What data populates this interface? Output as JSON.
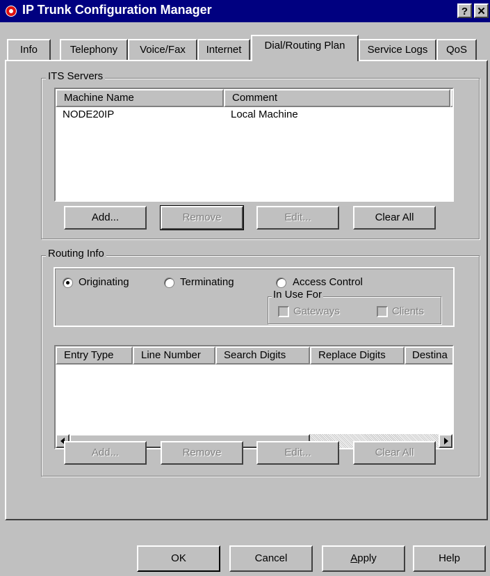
{
  "window": {
    "title": "IP Trunk Configuration Manager",
    "help_glyph": "?",
    "close_glyph": "✕"
  },
  "tabs": [
    {
      "label": "Info"
    },
    {
      "label": "Telephony"
    },
    {
      "label": "Voice/Fax"
    },
    {
      "label": "Internet"
    },
    {
      "label": "Dial/Routing Plan",
      "active": true
    },
    {
      "label": "Service Logs"
    },
    {
      "label": "QoS"
    }
  ],
  "its_servers": {
    "legend": "ITS Servers",
    "columns": [
      "Machine Name",
      "Comment"
    ],
    "rows": [
      {
        "machine": "NODE20IP",
        "comment": "Local Machine"
      }
    ],
    "buttons": {
      "add": "Add...",
      "remove": "Remove",
      "edit": "Edit...",
      "clear": "Clear All"
    }
  },
  "routing_info": {
    "legend": "Routing Info",
    "radios": {
      "originating": "Originating",
      "terminating": "Terminating",
      "access_control": "Access Control"
    },
    "selected": "Originating",
    "in_use_for": {
      "legend": "In Use For",
      "gateways": "Gateways",
      "clients": "Clients"
    },
    "columns": [
      "Entry Type",
      "Line Number",
      "Search Digits",
      "Replace Digits",
      "Destina"
    ],
    "buttons": {
      "add": "Add...",
      "remove": "Remove",
      "edit": "Edit...",
      "clear": "Clear All"
    }
  },
  "footer": {
    "ok": "OK",
    "cancel": "Cancel",
    "apply_rest": "pply",
    "apply_mnemonic": "A",
    "help": "Help"
  }
}
